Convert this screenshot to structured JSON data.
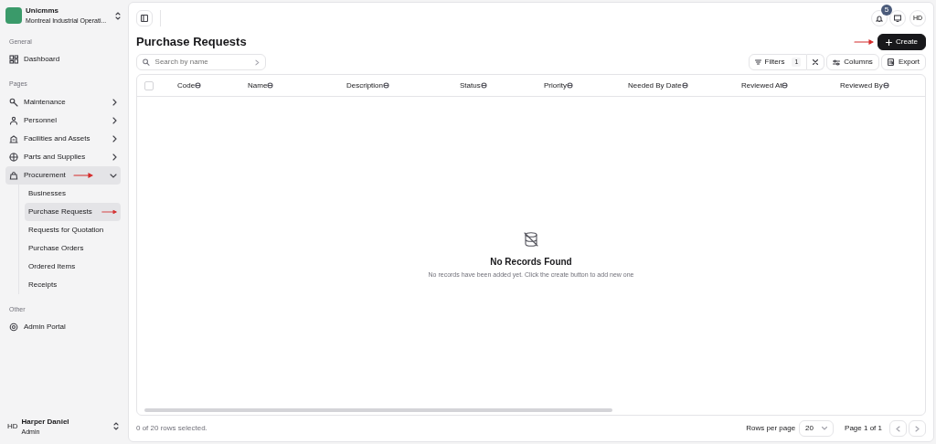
{
  "workspace": {
    "name": "Unicmms",
    "org": "Montreal Industrial Operati..."
  },
  "sidebar": {
    "sections": [
      {
        "title": "General",
        "items": [
          {
            "label": "Dashboard",
            "kind": "link",
            "selected": false,
            "arrow": false
          }
        ]
      },
      {
        "title": "Pages",
        "items": [
          {
            "label": "Maintenance",
            "kind": "group",
            "expanded": false,
            "selected": false,
            "arrow": false
          },
          {
            "label": "Personnel",
            "kind": "group",
            "expanded": false,
            "selected": false,
            "arrow": false
          },
          {
            "label": "Facilities and Assets",
            "kind": "group",
            "expanded": false,
            "selected": false,
            "arrow": false
          },
          {
            "label": "Parts and Supplies",
            "kind": "group",
            "expanded": false,
            "selected": false,
            "arrow": false
          },
          {
            "label": "Procurement",
            "kind": "group",
            "expanded": true,
            "selected": true,
            "arrow": true,
            "children": [
              {
                "label": "Businesses",
                "selected": false,
                "arrow": false
              },
              {
                "label": "Purchase Requests",
                "selected": true,
                "arrow": true
              },
              {
                "label": "Requests for Quotation",
                "selected": false,
                "arrow": false
              },
              {
                "label": "Purchase Orders",
                "selected": false,
                "arrow": false
              },
              {
                "label": "Ordered Items",
                "selected": false,
                "arrow": false
              },
              {
                "label": "Receipts",
                "selected": false,
                "arrow": false
              }
            ]
          }
        ]
      },
      {
        "title": "Other",
        "items": [
          {
            "label": "Admin Portal",
            "kind": "link",
            "selected": false,
            "arrow": false
          }
        ]
      }
    ]
  },
  "user": {
    "initials": "HD",
    "name": "Harper Daniel",
    "role": "Admin"
  },
  "header": {
    "notification_count": "5",
    "avatar": "HD"
  },
  "page": {
    "title": "Purchase Requests",
    "create_button": "Create",
    "create_arrow": true
  },
  "search": {
    "placeholder": "Search by name"
  },
  "toolbar": {
    "filters": "Filters",
    "filter_count": "1",
    "columns": "Columns",
    "export": "Export"
  },
  "table": {
    "select_all_checked": false,
    "columns": [
      "Code",
      "Name",
      "Description",
      "Status",
      "Priority",
      "Needed By Date",
      "Reviewed At",
      "Reviewed By"
    ]
  },
  "empty_state": {
    "title": "No Records Found",
    "message": "No records have been added yet. Click the create button to add new one"
  },
  "footer": {
    "selection": "0 of 20 rows selected.",
    "rows_per_page_label": "Rows per page",
    "rows_per_page": "20",
    "page": "Page 1 of 1"
  }
}
